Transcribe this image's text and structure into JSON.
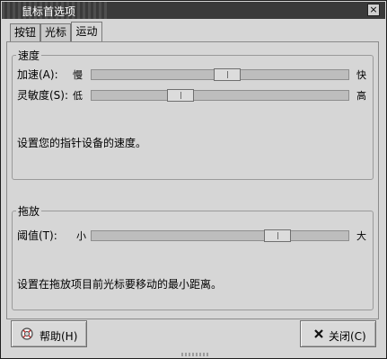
{
  "window": {
    "title": "鼠标首选项",
    "close_glyph": "×"
  },
  "tabs": [
    {
      "label": "按钮",
      "active": false
    },
    {
      "label": "光标",
      "active": false
    },
    {
      "label": "运动",
      "active": true
    }
  ],
  "speed": {
    "title": "速度",
    "acceleration": {
      "label": "加速(A):",
      "min_label": "慢",
      "max_label": "快",
      "value": 0.53
    },
    "sensitivity": {
      "label": "灵敏度(S):",
      "min_label": "低",
      "max_label": "高",
      "value": 0.33
    },
    "description": "设置您的指针设备的速度。"
  },
  "drag": {
    "title": "拖放",
    "threshold": {
      "label": "阈值(T):",
      "min_label": "小",
      "max_label": "大",
      "value": 0.75
    },
    "description": "设置在拖放项目前光标要移动的最小距离。"
  },
  "buttons": {
    "help": {
      "label": "帮助(H)",
      "icon": "help-icon"
    },
    "close": {
      "label": "关闭(C)",
      "icon": "close-icon"
    }
  },
  "colors": {
    "titlebar": "#3a3a3a",
    "window_bg": "#d6d6d6"
  }
}
